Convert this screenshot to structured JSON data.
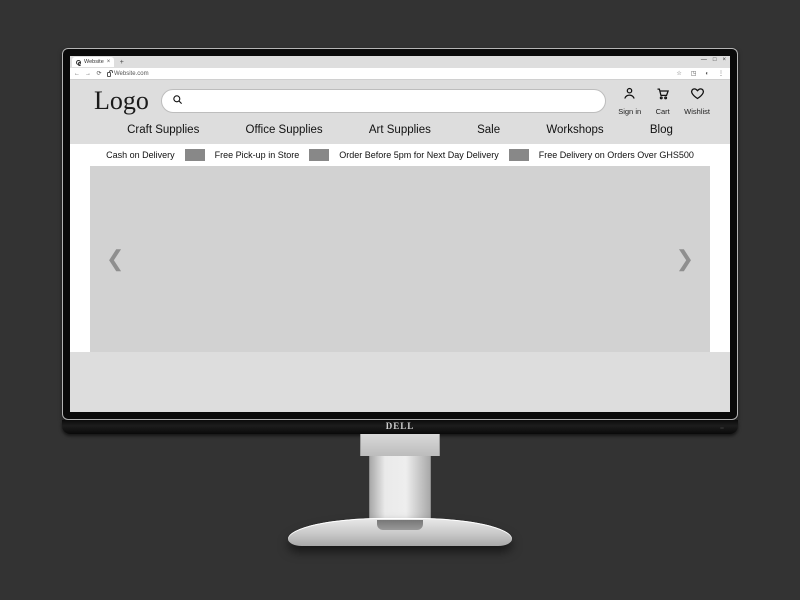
{
  "browser": {
    "tab_title": "Website",
    "url": "Website.com"
  },
  "site": {
    "logo_text": "Logo",
    "search_placeholder": "",
    "account": {
      "signin": "Sign in",
      "cart": "Cart",
      "wishlist": "Wishlist"
    },
    "nav": {
      "craft": "Craft Supplies",
      "office": "Office Supplies",
      "art": "Art Supplies",
      "sale": "Sale",
      "workshops": "Workshops",
      "blog": "Blog"
    },
    "usps": {
      "cod": "Cash on Delivery",
      "pickup": "Free Pick-up in Store",
      "nextday": "Order Before 5pm for Next Day Delivery",
      "freedel": "Free Delivery on Orders Over GHS500"
    }
  },
  "hardware": {
    "brand": "DELL"
  }
}
